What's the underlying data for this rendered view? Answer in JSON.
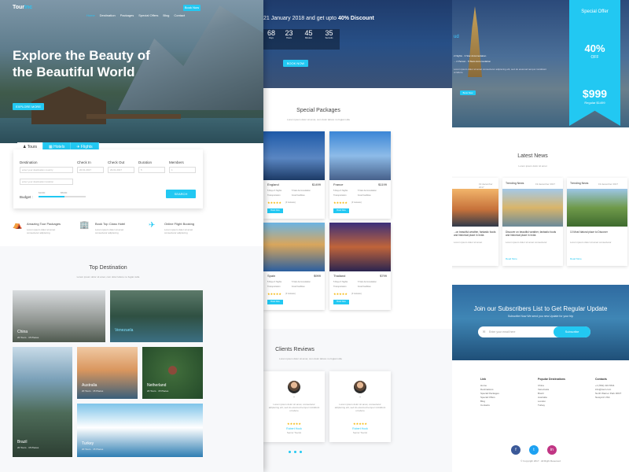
{
  "brand": {
    "a": "Tour",
    "b": "Inc"
  },
  "nav": [
    "Home",
    "Destination",
    "Packages",
    "Special Offers",
    "Blog",
    "Contact"
  ],
  "nav_button": "Book Now",
  "hero": {
    "title": "Explore the Beauty of the Beautiful World",
    "button": "EXPLORE MORE"
  },
  "search": {
    "tabs": [
      "Tours",
      "Hotels",
      "Flights"
    ],
    "destination_label": "Destination",
    "destination_placeholder": "enter your destination country",
    "destination2_placeholder": "enter your destination location",
    "checkin_label": "Check In",
    "checkin_value": "20.01.2017",
    "checkout_label": "Check Out",
    "checkout_value": "29.01.2017",
    "duration_label": "Duration",
    "duration_value": "5",
    "members_label": "Members",
    "members_value": "1",
    "budget_label": "Budget :",
    "budget_min": "$1000",
    "budget_max": "$5000",
    "budget_level": 0.55,
    "button": "SEARCH"
  },
  "features": [
    {
      "title": "Amazing Tour Packages",
      "text": "Lorem ipsum dolor sit amet consectetur adipiscing"
    },
    {
      "title": "Book Top Class Hotel",
      "text": "Lorem ipsum dolor sit amet consectetur adipiscing"
    },
    {
      "title": "Online Flight Booking",
      "text": "Lorem ipsum dolor sit amet consectetur adipiscing"
    }
  ],
  "top_destination": {
    "title": "Top Destination",
    "subtitle": "Lorem ipsum dolor sit amet, cum dolor labore no fugiat nulla",
    "items": [
      {
        "name": "China",
        "sub": "20 Tours · 15 Places"
      },
      {
        "name": "Venezuela",
        "sub": "20 Tours · 15 Places"
      },
      {
        "name": "Australia",
        "sub": "20 Tours · 15 Places"
      },
      {
        "name": "Netherland",
        "sub": "20 Tours · 15 Places"
      },
      {
        "name": "Brazil",
        "sub": "20 Tours · 15 Places"
      },
      {
        "name": "Turkey",
        "sub": "20 Tours · 15 Places"
      }
    ]
  },
  "countdown": {
    "headline_pre": "21 January 2018 and get upto ",
    "headline_bold": "40% Discount",
    "units": [
      {
        "v": "68",
        "l": "Days"
      },
      {
        "v": "23",
        "l": "Hours"
      },
      {
        "v": "45",
        "l": "Minutes"
      },
      {
        "v": "35",
        "l": "Seconds"
      }
    ],
    "button": "BOOK NOW"
  },
  "packages": {
    "title": "Special Packages",
    "subtitle": "Lorem ipsum dolor sit amet, cum dolor labore no fugiat nulla",
    "items": [
      {
        "name": "England",
        "price": "$1499",
        "l1": "5 Days 6 Nights",
        "l2": "5 Star Accomodation",
        "l3": "Transportation",
        "l4": "Food Facilities",
        "reviews": "(3 reviews)",
        "btn": "Book Now"
      },
      {
        "name": "France",
        "price": "$1199",
        "l1": "5 Days 6 Nights",
        "l2": "5 Star Accomodation",
        "l3": "Transportation",
        "l4": "Food Facilities",
        "reviews": "(3 reviews)",
        "btn": "Book Now"
      },
      {
        "name": "Spain",
        "price": "$999",
        "l1": "5 Days 6 Nights",
        "l2": "5 Star Accomodation",
        "l3": "Transportation",
        "l4": "Food Facilities",
        "reviews": "(3 reviews)",
        "btn": "Book Now"
      },
      {
        "name": "Thailand",
        "price": "$799",
        "l1": "5 Days 6 Nights",
        "l2": "5 Star Accomodation",
        "l3": "Transportation",
        "l4": "Food Facilities",
        "reviews": "(3 reviews)",
        "btn": "Book Now"
      }
    ]
  },
  "reviews": {
    "title": "Clients Reviews",
    "subtitle": "Lorem ipsum dolor sit amet, cum dolor labore no fugiat nulla",
    "items": [
      {
        "text": "Lorem ipsum dolor sit amet, consectetur adipiscing elit, sed do eiusmod tempor incididunt ut labore",
        "name": "Robert Hook",
        "role": "Senior Tourist"
      },
      {
        "text": "Lorem ipsum dolor sit amet, consectetur adipiscing elit, sed do eiusmod tempor incididunt ut labore",
        "name": "Robert Hook",
        "role": "Senior Tourist"
      }
    ]
  },
  "offer_info": {
    "title": "ud",
    "l1": "2 Nights · 3 Star Accomodation",
    "l2": "... 2 Person · 5 Stars Accomodation",
    "text": "Lorem ipsum dolor sit amet consectetur adipiscing elit, sed do eiusmod tempor incididunt ut labore",
    "button": "Book Now"
  },
  "special_offer": {
    "label": "Special Offer",
    "pct": "40%",
    "off": "OFF",
    "price": "$999",
    "regular": "Regular $1499"
  },
  "news": {
    "title": "Latest News",
    "subtitle": "Lorem ipsum dolor sit amet",
    "items": [
      {
        "tag": "",
        "date": "19 december 2017",
        "title": "...on beautiful weather, fantastic foods and historical place in India",
        "text": "Lorem ipsum dolor sit amet",
        "more": ""
      },
      {
        "tag": "Trending News",
        "date": "19 december 2017",
        "title": "Discover on beautiful weather, fantastic foods and historical place in India",
        "text": "Lorem ipsum dolor sit amet consectetur",
        "more": "Read More"
      },
      {
        "tag": "Trending News",
        "date": "19 december 2017",
        "title": "10 Most Natural place to Discover",
        "text": "Lorem ipsum dolor sit amet consectetur",
        "more": "Read More"
      }
    ]
  },
  "subscribe": {
    "title": "Join our Subscribers List to Get Regular Update",
    "subtitle": "Subscribe Now We send you new Update for your trip",
    "placeholder": "Enter your email here",
    "button": "Subscribe"
  },
  "footer": {
    "col1": {
      "title": "Link",
      "items": [
        "Home",
        "Destinations",
        "Special Packages",
        "Special Offers",
        "Blog",
        "Contacts"
      ]
    },
    "col2": {
      "title": "Popular Destinations",
      "items": [
        "China",
        "Venezuela",
        "Brazil",
        "Australia",
        "London",
        "Turkey"
      ]
    },
    "col3": {
      "title": "Contacts",
      "items": [
        "+1 (562) 224 6541",
        "info@touri.com",
        "North Warner Park 306/7",
        "Newyork USA"
      ]
    },
    "social": [
      "f",
      "t",
      "in"
    ],
    "copyright": "© Copyright 2017 · All Right Reserved"
  },
  "colors": {
    "accent": "#22c8f2",
    "star": "#f4b400",
    "facebook": "#3b5998",
    "twitter": "#1da1f2",
    "instagram": "#c13584"
  }
}
